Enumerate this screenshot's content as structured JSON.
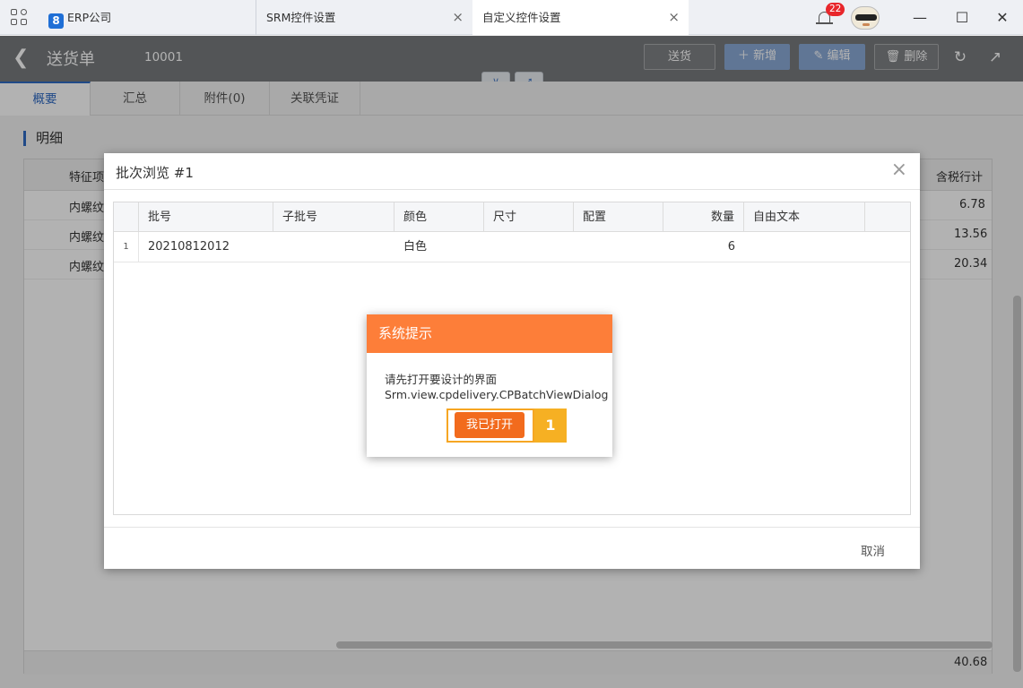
{
  "titlebar": {
    "tabs": [
      {
        "label": "ERP公司",
        "logo": "8"
      },
      {
        "label": "SRM控件设置"
      },
      {
        "label": "自定义控件设置"
      }
    ],
    "notification_count": "22",
    "close_glyph": "×"
  },
  "header": {
    "title": "送货单",
    "doc_no": "10001",
    "buttons": {
      "send": "送货",
      "new": "新增",
      "edit": "编辑",
      "delete": "删除"
    }
  },
  "subtabs": [
    "概要",
    "汇总",
    "附件(0)",
    "关联凭证"
  ],
  "section": {
    "label": "明细"
  },
  "background_grid": {
    "col_feature": "特征项",
    "col_total": "含税行计",
    "rows": [
      {
        "feature": "内螺纹",
        "total": "6.78"
      },
      {
        "feature": "内螺纹",
        "total": "13.56"
      },
      {
        "feature": "内螺纹",
        "total": "20.34"
      }
    ],
    "footer_total": "40.68"
  },
  "batch_dialog": {
    "title": "批次浏览 #1",
    "columns": [
      "批号",
      "子批号",
      "颜色",
      "尺寸",
      "配置",
      "数量",
      "自由文本"
    ],
    "rows": [
      {
        "index": "1",
        "batch": "20210812012",
        "sub_batch": "",
        "color": "白色",
        "size": "",
        "config": "",
        "qty": "6",
        "free_text": ""
      }
    ],
    "cancel_label": "取消"
  },
  "system_prompt": {
    "title": "系统提示",
    "message_line1": "请先打开要设计的界面",
    "message_line2": "Srm.view.cpdelivery.CPBatchViewDialog",
    "confirm_label": "我已打开",
    "step_marker": "1"
  },
  "colors": {
    "accent_blue": "#2f6ac3",
    "prompt_orange": "#fd7e39",
    "confirm_orange": "#f26b1d",
    "highlight_yellow": "#f6b023",
    "badge_red": "#e8262b"
  }
}
